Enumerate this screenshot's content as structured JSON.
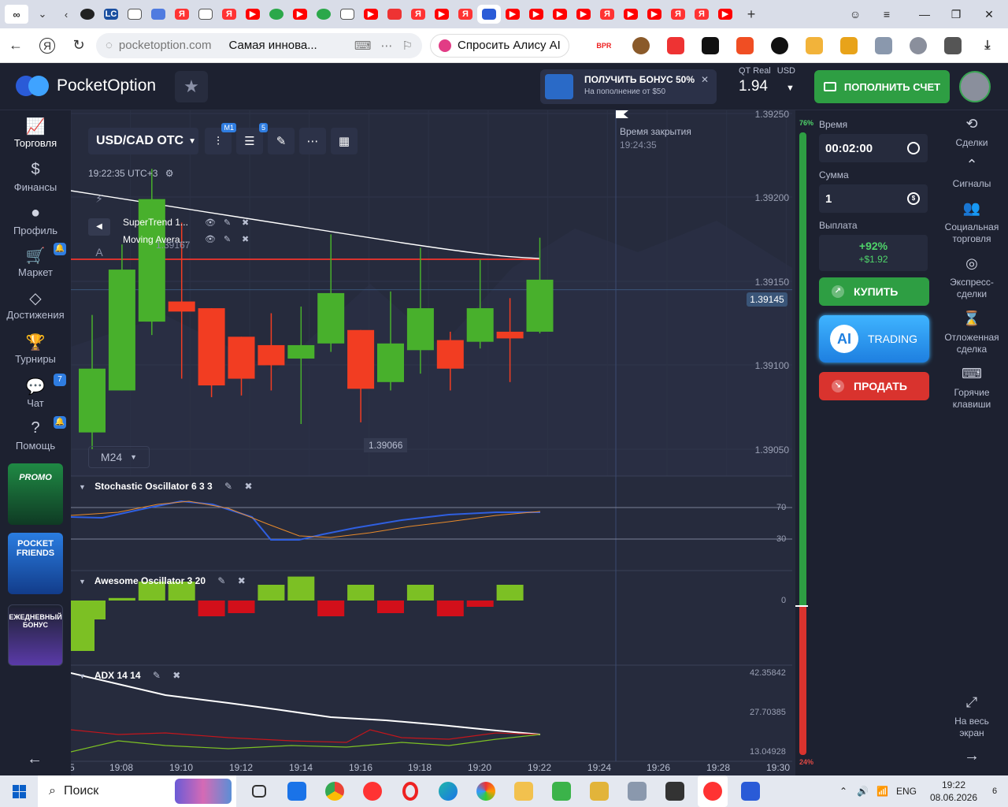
{
  "browser": {
    "url": "pocketoption.com",
    "page_title": "Самая иннова...",
    "alice_label": "Спросить Алису AI",
    "tab_strip_first": "∞",
    "ext_labels": [
      "BPR"
    ]
  },
  "header": {
    "brand": "PocketOption",
    "bonus_title": "ПОЛУЧИТЬ БОНУС 50%",
    "bonus_sub": "На пополнение от $50",
    "account_type": "QT Real",
    "currency": "USD",
    "balance": "1.94",
    "deposit_label": "ПОПОЛНИТЬ СЧЕТ"
  },
  "left_nav": [
    {
      "label": "Торговля",
      "icon": "chart-icon"
    },
    {
      "label": "Финансы",
      "icon": "dollar-icon"
    },
    {
      "label": "Профиль",
      "icon": "user-icon"
    },
    {
      "label": "Маркет",
      "icon": "cart-icon",
      "badge": "🔔"
    },
    {
      "label": "Достижения",
      "icon": "diamond-icon"
    },
    {
      "label": "Турниры",
      "icon": "trophy-icon"
    },
    {
      "label": "Чат",
      "icon": "chat-icon",
      "badge": "7"
    },
    {
      "label": "Помощь",
      "icon": "help-icon",
      "badge": "🔔"
    }
  ],
  "promos": [
    {
      "label": "PROMO",
      "color": "#1f6e3a"
    },
    {
      "label": "POCKET FRIENDS",
      "color": "#1a5fc8"
    },
    {
      "label": "ЕЖЕДНЕВНЫЙ БОНУС",
      "color": "#4a3a8c"
    }
  ],
  "chart_toolbar": {
    "pair": "USD/CAD OTC",
    "candles_badge": "M1",
    "indicators_badge": "5",
    "time": "19:22:35 UTC+3",
    "timeframe": "M24"
  },
  "indicators": [
    {
      "name": "SuperTrend 1..."
    },
    {
      "name": "Moving Avera..."
    }
  ],
  "expiry": {
    "label": "Время закрытия",
    "time": "19:24:35"
  },
  "price_axis": [
    "1.39250",
    "1.39200",
    "1.39150",
    "1.39100",
    "1.39050"
  ],
  "current_price": "1.39145",
  "high_label": "1.39167",
  "low_label": "1.39066",
  "panes": {
    "stochastic": {
      "title": "Stochastic Oscillator",
      "params": "6 3 3",
      "levels": [
        "70",
        "30"
      ]
    },
    "awesome": {
      "title": "Awesome Oscillator",
      "params": "3 20",
      "zero": "0"
    },
    "adx": {
      "title": "ADX",
      "params": "14 14",
      "levels": [
        "42.35842",
        "27.70385",
        "13.04928"
      ]
    }
  },
  "time_axis": [
    "5",
    "19:08",
    "19:10",
    "19:12",
    "19:14",
    "19:16",
    "19:18",
    "19:20",
    "19:22",
    "19:24",
    "19:26",
    "19:28",
    "19:30"
  ],
  "gauge": {
    "up": "76%",
    "down": "24%",
    "up_fraction": 0.76
  },
  "trade_panel": {
    "time_label": "Время",
    "time_value": "00:02:00",
    "amount_label": "Сумма",
    "amount_value": "1",
    "payout_label": "Выплата",
    "payout_pct": "+92%",
    "payout_amount": "+$1.92",
    "buy_label": "КУПИТЬ",
    "ai_label": "TRADING",
    "ai_short": "AI",
    "sell_label": "ПРОДАТЬ",
    "buy_color": "#2e9e43",
    "sell_color": "#d9332e"
  },
  "right_nav": [
    {
      "label": "Сделки",
      "icon": "history-icon"
    },
    {
      "label": "Сигналы",
      "icon": "signal-icon"
    },
    {
      "label": "Социальная торговля",
      "icon": "social-icon"
    },
    {
      "label": "Экспресс-сделки",
      "icon": "express-icon"
    },
    {
      "label": "Отложенная сделка",
      "icon": "hourglass-icon"
    },
    {
      "label": "Горячие клавиши",
      "icon": "keyboard-icon"
    },
    {
      "label": "На весь экран",
      "icon": "fullscreen-icon"
    }
  ],
  "taskbar": {
    "search": "Поиск",
    "lang": "ENG",
    "time": "19:22",
    "date": "08.06.2026",
    "notifications": "6"
  },
  "chart_data": {
    "type": "candlestick",
    "ylim": [
      1.3902,
      1.3926
    ],
    "candles": [
      {
        "o": 1.3906,
        "c": 1.39098,
        "h": 1.3913,
        "l": 1.3905
      },
      {
        "o": 1.39085,
        "c": 1.39157,
        "h": 1.39172,
        "l": 1.39085
      },
      {
        "o": 1.39126,
        "c": 1.39199,
        "h": 1.39217,
        "l": 1.39118
      },
      {
        "o": 1.39138,
        "c": 1.39132,
        "h": 1.39185,
        "l": 1.39092
      },
      {
        "o": 1.39134,
        "c": 1.39088,
        "h": 1.39134,
        "l": 1.39081
      },
      {
        "o": 1.39117,
        "c": 1.39092,
        "h": 1.39117,
        "l": 1.39082
      },
      {
        "o": 1.39112,
        "c": 1.391,
        "h": 1.39131,
        "l": 1.39085
      },
      {
        "o": 1.39104,
        "c": 1.39112,
        "h": 1.39135,
        "l": 1.39065
      },
      {
        "o": 1.39113,
        "c": 1.39143,
        "h": 1.39178,
        "l": 1.39108
      },
      {
        "o": 1.39121,
        "c": 1.39086,
        "h": 1.39121,
        "l": 1.39066
      },
      {
        "o": 1.3909,
        "c": 1.39113,
        "h": 1.39144,
        "l": 1.39085
      },
      {
        "o": 1.39109,
        "c": 1.39134,
        "h": 1.3917,
        "l": 1.39095
      },
      {
        "o": 1.39115,
        "c": 1.39098,
        "h": 1.3912,
        "l": 1.39085
      },
      {
        "o": 1.39114,
        "c": 1.39134,
        "h": 1.39163,
        "l": 1.3911
      },
      {
        "o": 1.3912,
        "c": 1.39116,
        "h": 1.3914,
        "l": 1.3909
      },
      {
        "o": 1.3912,
        "c": 1.39151,
        "h": 1.39176,
        "l": 1.39119
      }
    ],
    "awesome": [
      -0.8,
      -0.3,
      0.04,
      0.3,
      0.3,
      -0.25,
      -0.2,
      0.25,
      0.38,
      -0.25,
      0.25,
      -0.2,
      0.25,
      -0.25,
      -0.1,
      0.25
    ],
    "awesome_colors": [
      "g",
      "g",
      "g",
      "g",
      "g",
      "r",
      "r",
      "g",
      "g",
      "r",
      "g",
      "r",
      "g",
      "r",
      "r",
      "g"
    ]
  }
}
